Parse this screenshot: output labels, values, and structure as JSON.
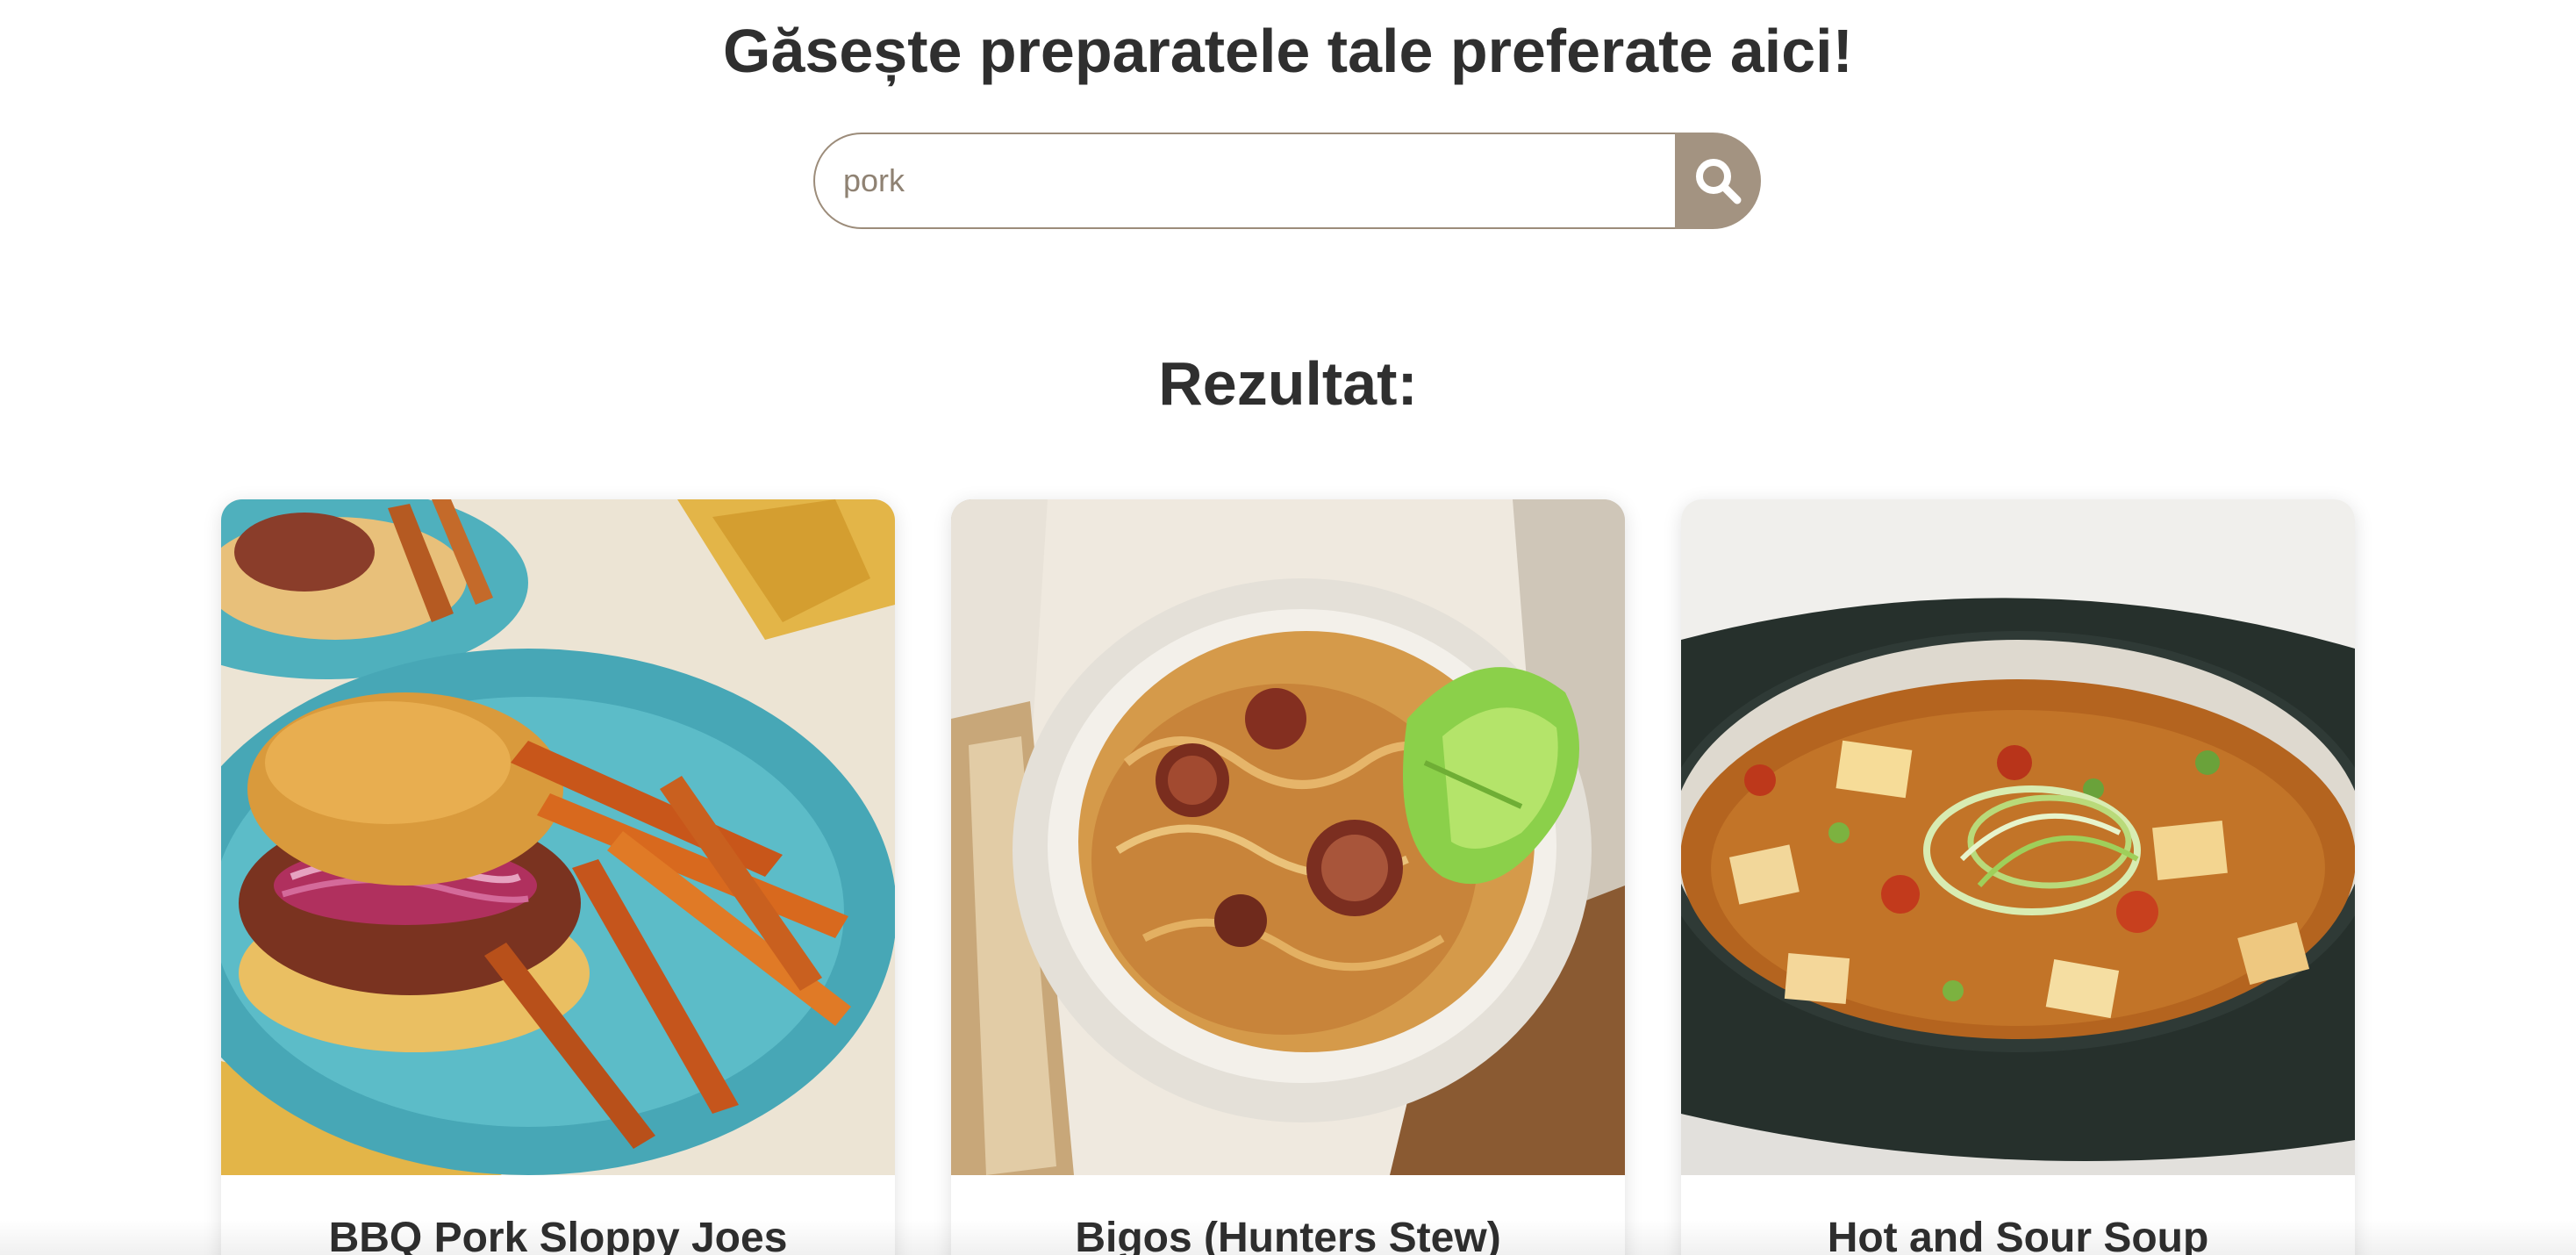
{
  "header": {
    "title": "Găsește preparatele tale preferate aici!"
  },
  "search": {
    "value": "pork",
    "button_icon": "search-icon",
    "accent_color": "#a39381"
  },
  "results": {
    "title": "Rezultat:",
    "cards": [
      {
        "title": "BBQ Pork Sloppy Joes",
        "image": "sloppy-joe-with-sweet-potato-fries"
      },
      {
        "title": "Bigos (Hunters Stew)",
        "image": "bigos-stew-bowl"
      },
      {
        "title": "Hot and Sour Soup",
        "image": "hot-and-sour-soup-bowl"
      }
    ]
  }
}
